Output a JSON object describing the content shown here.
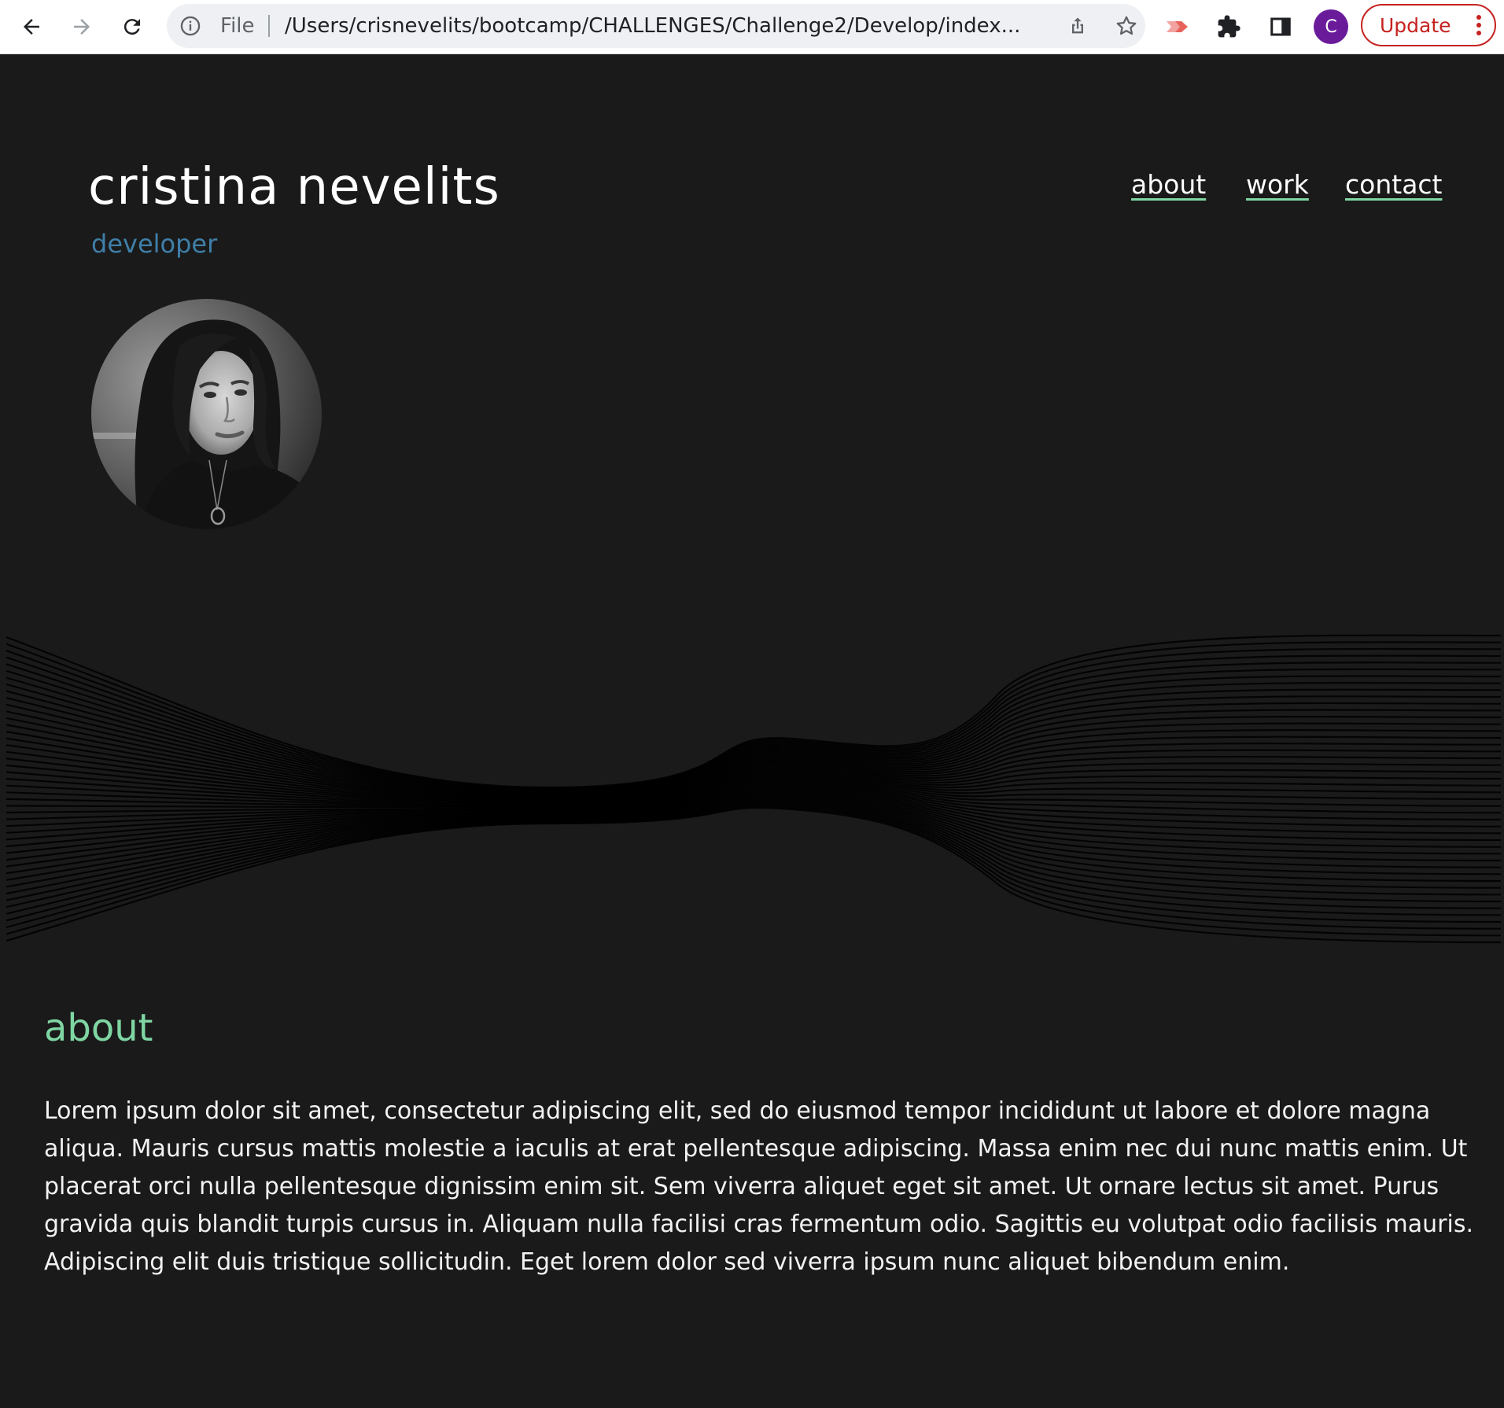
{
  "browser": {
    "omnibox_label": "File",
    "url": "/Users/crisnevelits/bootcamp/CHALLENGES/Challenge2/Develop/index...",
    "profile_initial": "C",
    "update_label": "Update",
    "icons": [
      "back-arrow-icon",
      "forward-arrow-icon",
      "reload-icon",
      "info-icon",
      "share-icon",
      "star-icon",
      "extension-arrow-icon",
      "puzzle-icon",
      "sidebar-icon",
      "more-vert-icon"
    ]
  },
  "header": {
    "name": "cristina nevelits",
    "role": "developer"
  },
  "nav": {
    "items": [
      "about",
      "work",
      "contact"
    ]
  },
  "about": {
    "heading": "about",
    "body": "Lorem ipsum dolor sit amet, consectetur adipiscing elit, sed do eiusmod tempor incididunt ut labore et dolore magna aliqua. Mauris cursus mattis molestie a iaculis at erat pellentesque adipiscing. Massa enim nec dui nunc mattis enim. Ut placerat orci nulla pellentesque dignissim enim sit. Sem viverra aliquet eget sit amet. Ut ornare lectus sit amet. Purus gravida quis blandit turpis cursus in. Aliquam nulla facilisi cras fermentum odio. Sagittis eu volutpat odio facilisis mauris. Adipiscing elit duis tristique sollicitudin. Eget lorem dolor sed viverra ipsum nunc aliquet bibendum enim."
  },
  "colors": {
    "background": "#1a1a1a",
    "accent_green": "#7fd6a3",
    "role_blue": "#3f7fa8",
    "text": "#ffffff",
    "update_red": "#c5221f"
  }
}
